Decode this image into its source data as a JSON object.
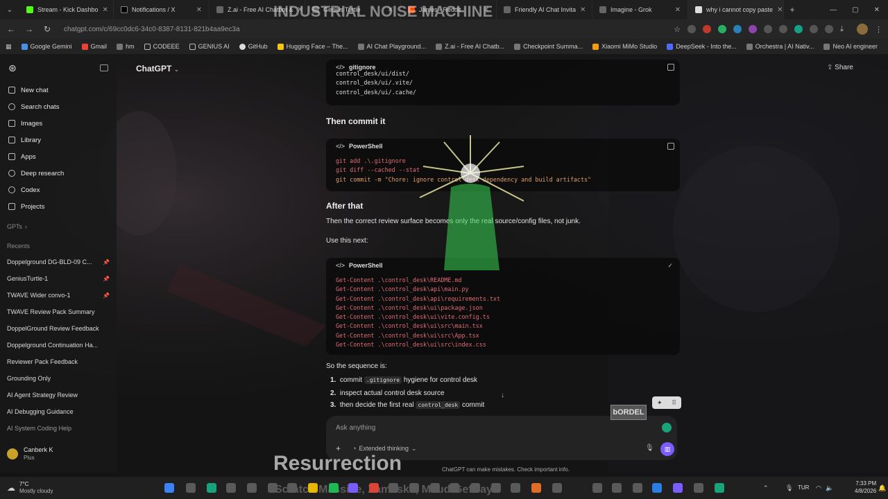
{
  "browser": {
    "tabs": [
      {
        "title": "Stream - Kick Dashbo"
      },
      {
        "title": "Notifications / X"
      },
      {
        "title": "Z.ai - Free AI Chatbot &"
      },
      {
        "title": "Genius Turtle"
      },
      {
        "title": "James - Reddit"
      },
      {
        "title": "Friendly AI Chat Invita"
      },
      {
        "title": "Imagine - Grok"
      },
      {
        "title": "why i cannot copy paste"
      }
    ],
    "url": "chatgpt.com/c/69cc0dc6-34c0-8387-8131-821b4aa9ec3a",
    "bookmarks": [
      "Google Gemini",
      "Gmail",
      "hm",
      "CODEEE",
      "GENIUS AI",
      "GitHub",
      "Hugging Face – The...",
      "AI Chat Playground...",
      "Z.ai - Free AI Chatb...",
      "Checkpoint Summa...",
      "Xiaomi MiMo Studio",
      "DeepSeek - Into the...",
      "Orchestra | AI Nativ...",
      "Neo AI engineer"
    ]
  },
  "sidebar": {
    "nav": [
      {
        "label": "New chat",
        "icon": "compose-icon"
      },
      {
        "label": "Search chats",
        "icon": "search-icon"
      },
      {
        "label": "Images",
        "icon": "images-icon"
      },
      {
        "label": "Library",
        "icon": "library-icon"
      },
      {
        "label": "Apps",
        "icon": "apps-icon"
      },
      {
        "label": "Deep research",
        "icon": "deep-research-icon"
      },
      {
        "label": "Codex",
        "icon": "codex-icon"
      },
      {
        "label": "Projects",
        "icon": "folder-icon"
      }
    ],
    "gpts_label": "GPTs",
    "recents_label": "Recents",
    "recents": [
      "Doppelground DG-BLD-09 C...",
      "GeniusTurtle-1",
      "TWAVE Wider convo-1",
      "TWAVE Review Pack Summary",
      "DoppelGround Review Feedback",
      "Doppelground Continuation Ha...",
      "Reviewer Pack Feedback",
      "Grounding Only",
      "AI Agent Strategy Review",
      "AI Debugging Guidance",
      "AI System Coding Help"
    ],
    "user": {
      "name": "Canberk K",
      "plan": "Plus"
    }
  },
  "header": {
    "model": "ChatGPT",
    "share_label": "Share"
  },
  "content": {
    "gitignore_block": {
      "lang": "gitignore",
      "lines": [
        "control_desk/ui/dist/",
        "control_desk/ui/.vite/",
        "control_desk/ui/.cache/"
      ]
    },
    "heading1": "Then commit it",
    "powershell_block1": {
      "lang": "PowerShell",
      "lines": [
        "git add .\\.gitignore",
        "git diff --cached --stat",
        "git commit -m \"Chore: ignore control desk dependency and build artifacts\""
      ]
    },
    "heading2": "After that",
    "para1": "Then the correct review surface becomes only the real source/config files, not junk.",
    "para2": "Use this next:",
    "powershell_block2": {
      "lang": "PowerShell",
      "lines": [
        "Get-Content .\\control_desk\\README.md",
        "Get-Content .\\control_desk\\api\\main.py",
        "Get-Content .\\control_desk\\api\\requirements.txt",
        "Get-Content .\\control_desk\\ui\\package.json",
        "Get-Content .\\control_desk\\ui\\vite.config.ts",
        "Get-Content .\\control_desk\\ui\\src\\main.tsx",
        "Get-Content .\\control_desk\\ui\\src\\App.tsx",
        "Get-Content .\\control_desk\\ui\\src\\index.css"
      ]
    },
    "sequence_intro": "So the sequence is:",
    "steps": [
      {
        "num": "1.",
        "pre": "commit",
        "code": ".gitignore",
        "post": "hygiene for control desk"
      },
      {
        "num": "2.",
        "pre": "inspect actual control desk source",
        "code": "",
        "post": ""
      },
      {
        "num": "3.",
        "pre": "then decide the first real",
        "code": "control_desk",
        "post": "commit"
      }
    ]
  },
  "composer": {
    "placeholder": "Ask anything",
    "thinking_label": "Extended thinking",
    "disclaimer": "ChatGPT can make mistakes. Check important info."
  },
  "overlay": {
    "top_title": "INDUSTRIAL NOISE MACHINE",
    "bottom_title": "Resurrection",
    "bottom_sub": "Scratch Massive, Zamilska, Maud Geffray",
    "badge": "bORDEL"
  },
  "taskbar": {
    "weather_temp": "7°C",
    "weather_desc": "Mostly cloudy",
    "lang": "TUR",
    "time": "7:33 PM",
    "date": "4/8/2026"
  },
  "colors": {
    "accent_purple": "#7b5cff",
    "code_red": "#e06c75",
    "code_blue": "#7aa6ff",
    "neon_green": "#39d353"
  }
}
